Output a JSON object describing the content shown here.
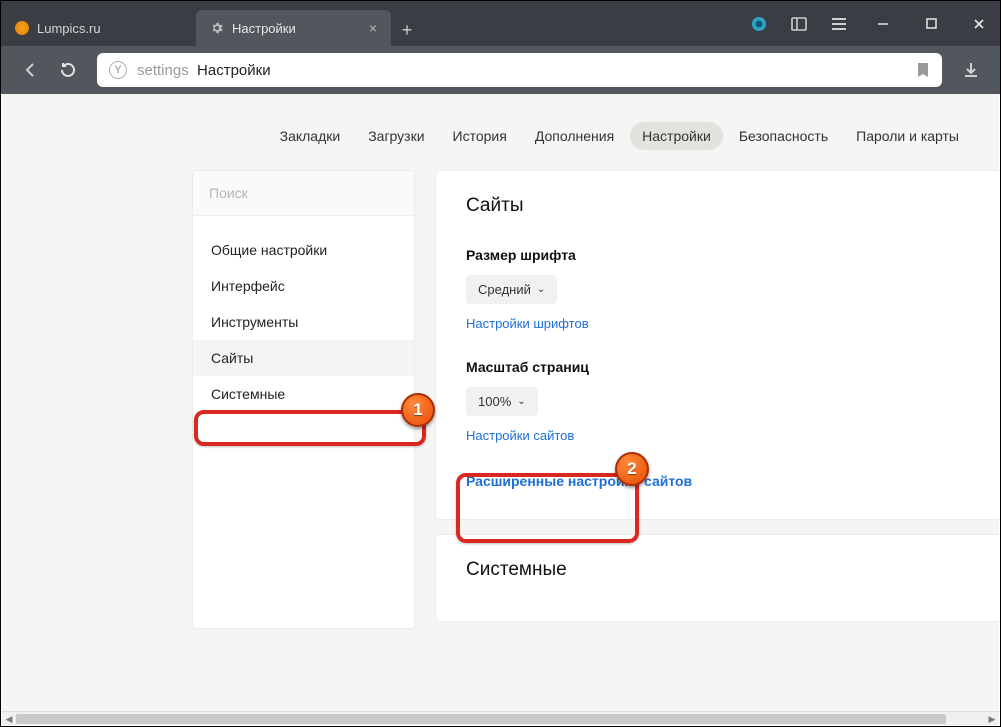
{
  "tabs": {
    "inactive_title": "Lumpics.ru",
    "active_title": "Настройки"
  },
  "address": {
    "scheme": "settings",
    "page": "Настройки"
  },
  "topnav": {
    "items": [
      "Закладки",
      "Загрузки",
      "История",
      "Дополнения",
      "Настройки",
      "Безопасность",
      "Пароли и карты"
    ],
    "active_index": 4
  },
  "sidebar": {
    "search_placeholder": "Поиск",
    "items": [
      "Общие настройки",
      "Интерфейс",
      "Инструменты",
      "Сайты",
      "Системные"
    ],
    "selected_index": 3
  },
  "main": {
    "card1": {
      "title": "Сайты",
      "font_label": "Размер шрифта",
      "font_value": "Средний",
      "font_link": "Настройки шрифтов",
      "zoom_label": "Масштаб страниц",
      "zoom_value": "100%",
      "zoom_link": "Настройки сайтов",
      "adv_link": "Расширенные настройки сайтов"
    },
    "card2_title": "Системные"
  },
  "markers": {
    "b1": "1",
    "b2": "2"
  }
}
